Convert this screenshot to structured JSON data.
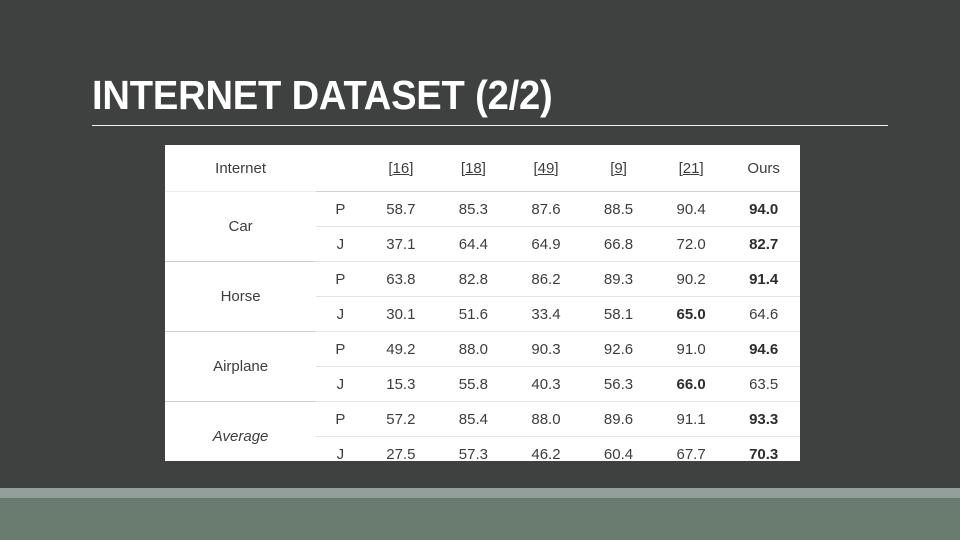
{
  "slide": {
    "title": "INTERNET DATASET (2/2)",
    "background_color": "#3f4040",
    "title_color": "#ffffff",
    "band_light_color": "#92a099",
    "band_dark_color": "#6a7b70"
  },
  "table": {
    "columns": [
      {
        "key": "label",
        "label": "Internet",
        "type": "text"
      },
      {
        "key": "metric",
        "label": "",
        "type": "text"
      },
      {
        "key": "c16",
        "label": "[16]",
        "ref": "16",
        "type": "ref"
      },
      {
        "key": "c18",
        "label": "[18]",
        "ref": "18",
        "type": "ref"
      },
      {
        "key": "c49",
        "label": "[49]",
        "ref": "49",
        "type": "ref"
      },
      {
        "key": "c9",
        "label": "[9]",
        "ref": "9",
        "type": "ref"
      },
      {
        "key": "c21",
        "label": "[21]",
        "ref": "21",
        "type": "ref"
      },
      {
        "key": "ours",
        "label": "Ours",
        "type": "text"
      }
    ],
    "groups": [
      {
        "label": "Car",
        "italic": false,
        "rows": [
          {
            "metric": "P",
            "values": [
              "58.7",
              "85.3",
              "87.6",
              "88.5",
              "90.4",
              "94.0"
            ],
            "bold": [
              false,
              false,
              false,
              false,
              false,
              true
            ]
          },
          {
            "metric": "J",
            "values": [
              "37.1",
              "64.4",
              "64.9",
              "66.8",
              "72.0",
              "82.7"
            ],
            "bold": [
              false,
              false,
              false,
              false,
              false,
              true
            ]
          }
        ]
      },
      {
        "label": "Horse",
        "italic": false,
        "rows": [
          {
            "metric": "P",
            "values": [
              "63.8",
              "82.8",
              "86.2",
              "89.3",
              "90.2",
              "91.4"
            ],
            "bold": [
              false,
              false,
              false,
              false,
              false,
              true
            ]
          },
          {
            "metric": "J",
            "values": [
              "30.1",
              "51.6",
              "33.4",
              "58.1",
              "65.0",
              "64.6"
            ],
            "bold": [
              false,
              false,
              false,
              false,
              true,
              false
            ]
          }
        ]
      },
      {
        "label": "Airplane",
        "italic": false,
        "rows": [
          {
            "metric": "P",
            "values": [
              "49.2",
              "88.0",
              "90.3",
              "92.6",
              "91.0",
              "94.6"
            ],
            "bold": [
              false,
              false,
              false,
              false,
              false,
              true
            ]
          },
          {
            "metric": "J",
            "values": [
              "15.3",
              "55.8",
              "40.3",
              "56.3",
              "66.0",
              "63.5"
            ],
            "bold": [
              false,
              false,
              false,
              false,
              true,
              false
            ]
          }
        ]
      },
      {
        "label": "Average",
        "italic": true,
        "rows": [
          {
            "metric": "P",
            "values": [
              "57.2",
              "85.4",
              "88.0",
              "89.6",
              "91.1",
              "93.3"
            ],
            "bold": [
              false,
              false,
              false,
              false,
              false,
              true
            ]
          },
          {
            "metric": "J",
            "values": [
              "27.5",
              "57.3",
              "46.2",
              "60.4",
              "67.7",
              "70.3"
            ],
            "bold": [
              false,
              false,
              false,
              false,
              false,
              true
            ]
          }
        ]
      }
    ]
  }
}
